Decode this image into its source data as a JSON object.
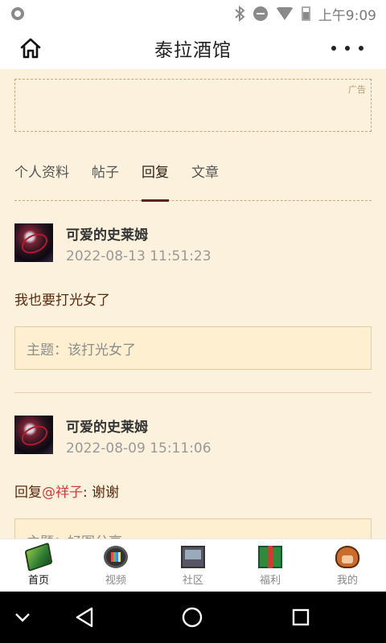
{
  "status_bar": {
    "time": "上午9:09",
    "icons": [
      "notification-icon",
      "bluetooth-icon",
      "do-not-disturb-icon",
      "wifi-icon",
      "battery-icon"
    ]
  },
  "header": {
    "title": "泰拉酒馆",
    "home_icon": "home-icon",
    "more_icon": "more-icon"
  },
  "ad": {
    "label": "广告"
  },
  "profile_tabs": [
    {
      "label": "个人资料",
      "active": false
    },
    {
      "label": "帖子",
      "active": false
    },
    {
      "label": "回复",
      "active": true
    },
    {
      "label": "文章",
      "active": false
    }
  ],
  "posts": [
    {
      "author": "可爱的史莱姆",
      "time": "2022-08-13 11:51:23",
      "body": "我也要打光女了",
      "topic": "主题：该打光女了"
    },
    {
      "author": "可爱的史莱姆",
      "time": "2022-08-09 15:11:06",
      "reply_prefix": "回复",
      "mention": "@祥子",
      "reply_text": ": 谢谢",
      "topic": "主题：好图分享"
    }
  ],
  "tab_bar": [
    {
      "label": "首页",
      "icon": "home-tab-icon",
      "active": true
    },
    {
      "label": "视频",
      "icon": "video-tab-icon",
      "active": false
    },
    {
      "label": "社区",
      "icon": "community-tab-icon",
      "active": false
    },
    {
      "label": "福利",
      "icon": "welfare-tab-icon",
      "active": false
    },
    {
      "label": "我的",
      "icon": "me-tab-icon",
      "active": false
    }
  ],
  "colors": {
    "background": "#fbf1dd",
    "accent": "#5a2410",
    "mention": "#d03c3c",
    "topic_bg": "#fdefcf"
  }
}
